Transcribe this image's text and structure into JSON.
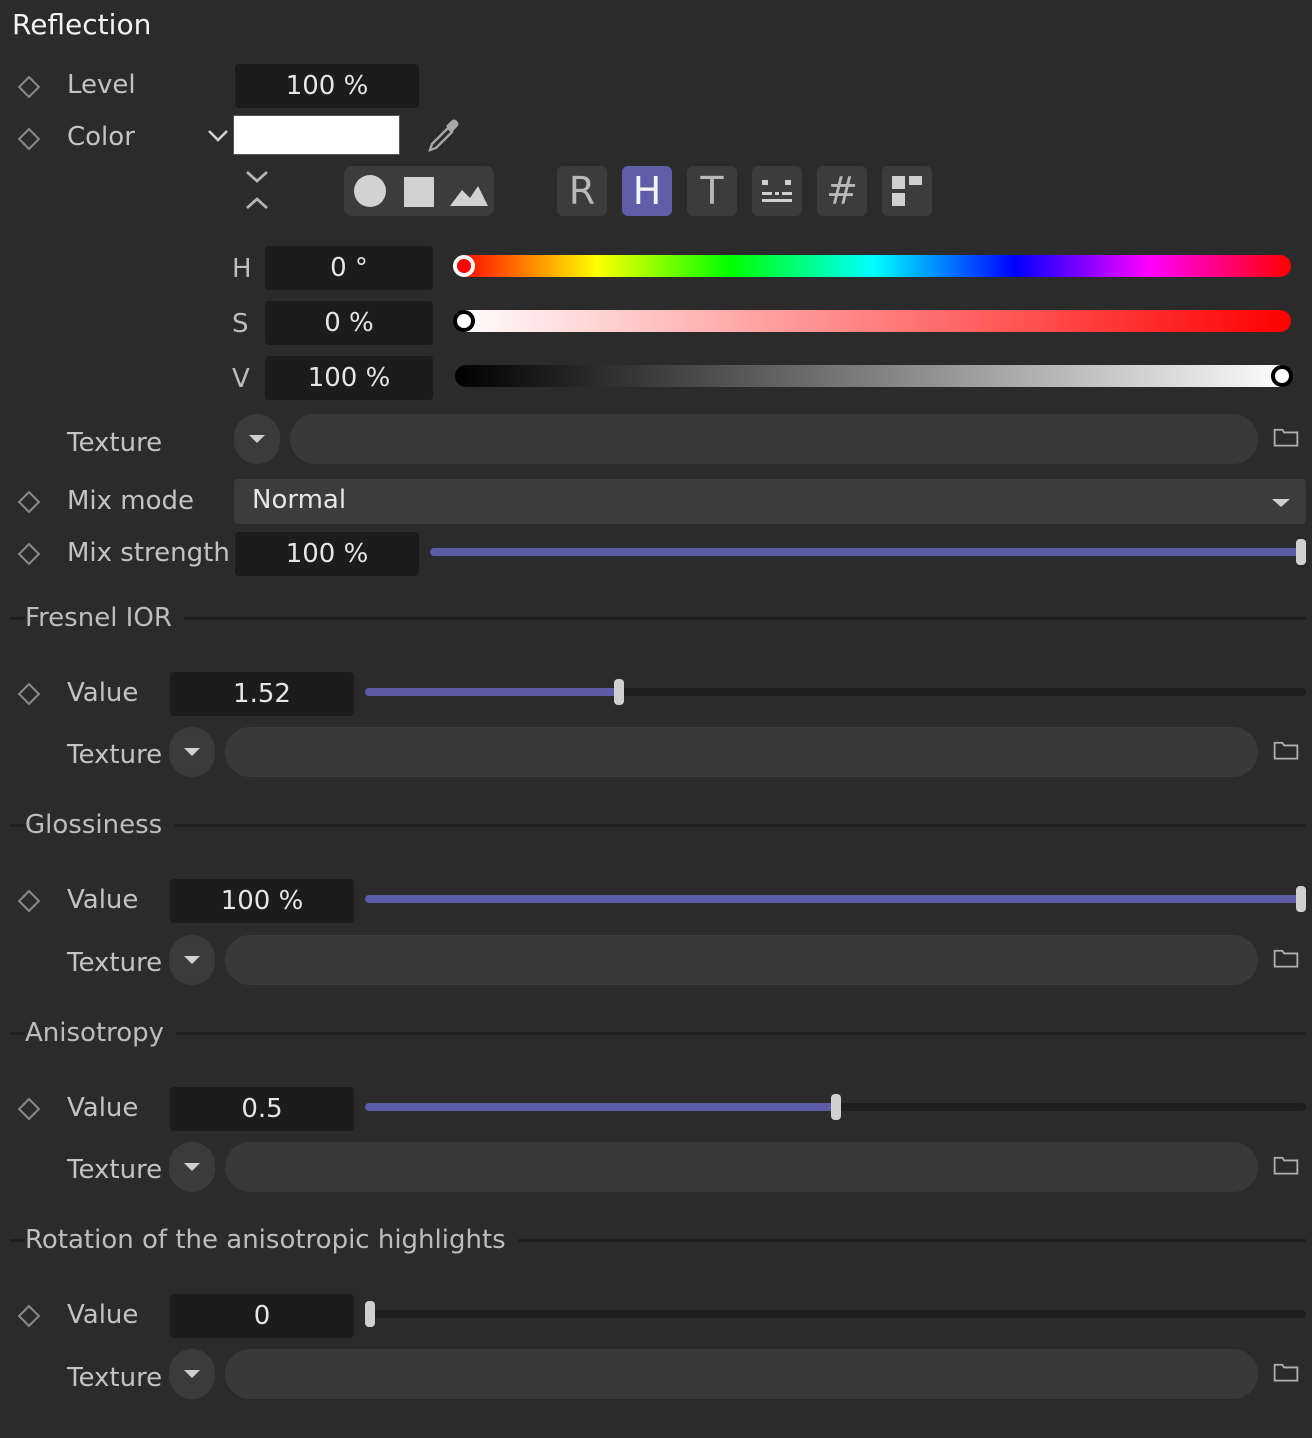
{
  "reflection": {
    "title": "Reflection",
    "level": {
      "label": "Level",
      "value": "100 %"
    },
    "color": {
      "label": "Color",
      "swatch": "#ffffff"
    },
    "modes": {
      "R": "R",
      "H": "H",
      "T": "T",
      "hash": "#"
    },
    "hsv": {
      "h": {
        "label": "H",
        "value": "0 °",
        "fraction": 0.0
      },
      "s": {
        "label": "S",
        "value": "0 %",
        "fraction": 0.0
      },
      "v": {
        "label": "V",
        "value": "100 %",
        "fraction": 1.0
      }
    },
    "texture": {
      "label": "Texture"
    },
    "mix_mode": {
      "label": "Mix mode",
      "value": "Normal"
    },
    "mix_strength": {
      "label": "Mix strength",
      "value": "100 %",
      "fraction": 1.0
    }
  },
  "fresnel": {
    "title": "Fresnel IOR",
    "value_label": "Value",
    "value": "1.52",
    "fraction": 0.27,
    "texture_label": "Texture"
  },
  "glossiness": {
    "title": "Glossiness",
    "value_label": "Value",
    "value": "100 %",
    "fraction": 1.0,
    "texture_label": "Texture"
  },
  "anisotropy": {
    "title": "Anisotropy",
    "value_label": "Value",
    "value": "0.5",
    "fraction": 0.5,
    "texture_label": "Texture"
  },
  "rotation": {
    "title": "Rotation of the anisotropic highlights",
    "value_label": "Value",
    "value": "0",
    "fraction": 0.0,
    "texture_label": "Texture"
  },
  "colors": {
    "accent": "#5c5da6",
    "panel": "#2b2b2b",
    "field": "#1c1c1c"
  }
}
